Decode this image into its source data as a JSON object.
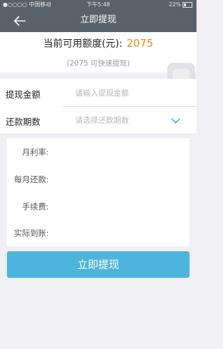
{
  "status_bar": {
    "carrier": "●○○○○ 中国移动",
    "time": "下午5:48",
    "battery": "22%"
  },
  "nav": {
    "title": "立即提现"
  },
  "quota": {
    "label": "当前可用额度(元):",
    "amount": "2075",
    "subtext": "(2075 可快速提现)"
  },
  "form": {
    "withdraw_label": "提现金额",
    "withdraw_placeholder": "请输入提现金额",
    "term_label": "还款期数",
    "term_placeholder": "请选择还款期数"
  },
  "details": {
    "monthly_rate": "月利率:",
    "monthly_repay": "每月还款:",
    "fee": "手续费:",
    "actual": "实际到账:"
  },
  "actions": {
    "submit": "立即提现"
  },
  "colors": {
    "nav_bg": "#59616a",
    "accent": "#f08a1c",
    "primary_button": "#4db4dd",
    "chevron": "#2aa7e4"
  },
  "icons": [
    "back-arrow-icon",
    "chevron-down-icon",
    "battery-icon",
    "wifi-icon"
  ]
}
